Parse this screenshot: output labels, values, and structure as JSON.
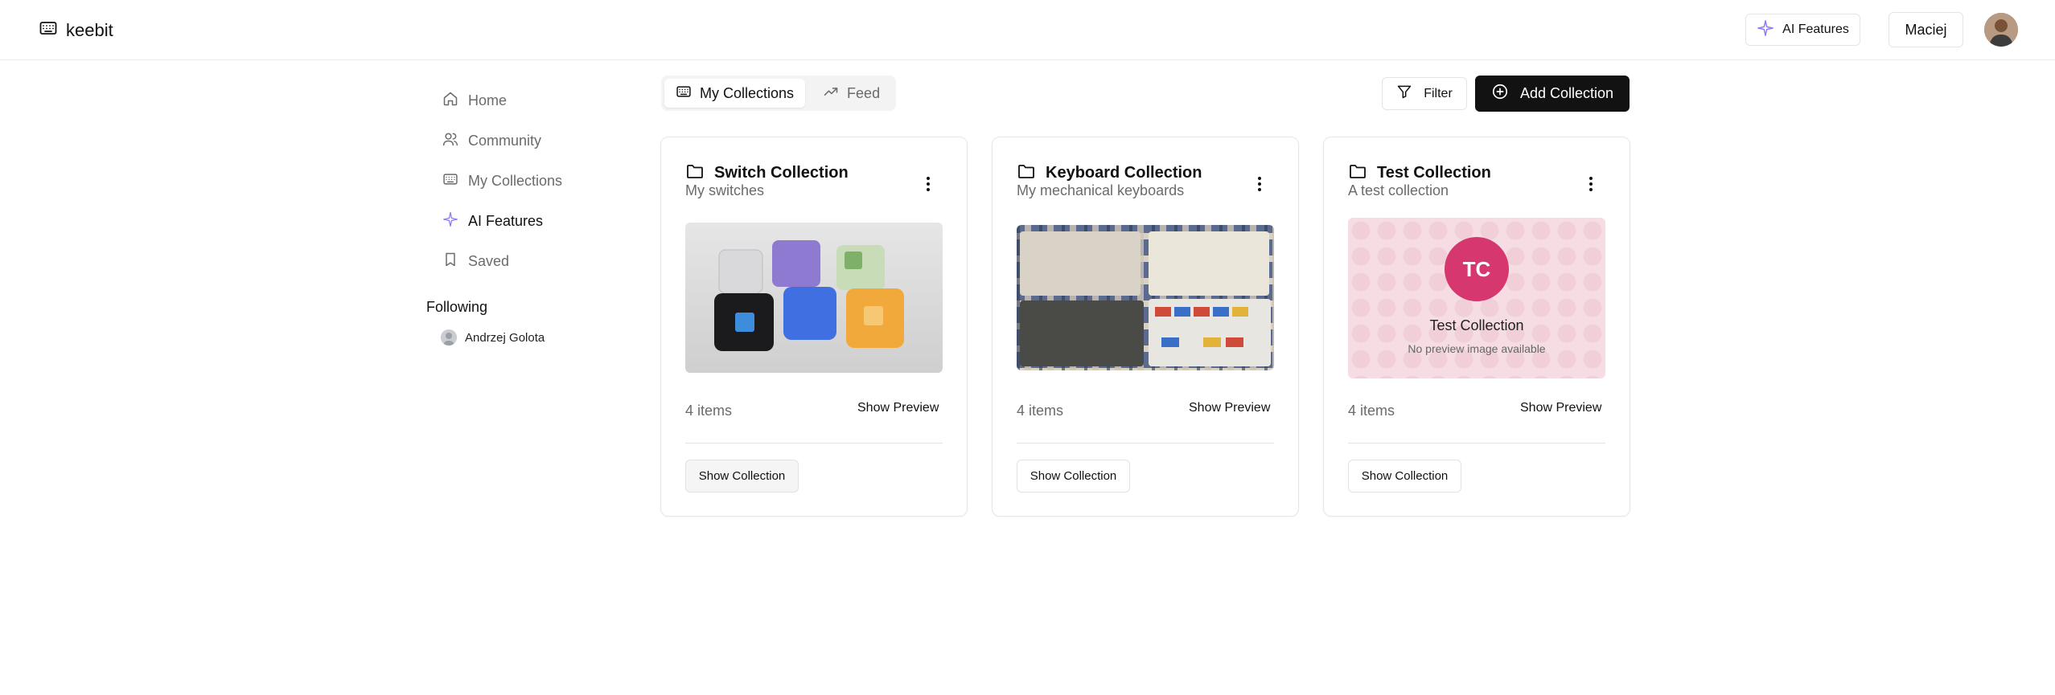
{
  "app": {
    "name": "keebit"
  },
  "header": {
    "ai_label": "AI Features",
    "user_name": "Maciej"
  },
  "sidebar": {
    "items": [
      {
        "label": "Home",
        "icon": "home-icon",
        "active": false
      },
      {
        "label": "Community",
        "icon": "users-icon",
        "active": false
      },
      {
        "label": "My Collections",
        "icon": "keyboard-icon",
        "active": false
      },
      {
        "label": "AI Features",
        "icon": "sparkles-icon",
        "active": true
      },
      {
        "label": "Saved",
        "icon": "bookmark-icon",
        "active": false
      }
    ],
    "following_title": "Following",
    "following": [
      {
        "name": "Andrzej Golota"
      }
    ]
  },
  "tabs": [
    {
      "label": "My Collections",
      "icon": "keyboard-icon",
      "active": true
    },
    {
      "label": "Feed",
      "icon": "trending-up-icon",
      "active": false
    }
  ],
  "actions": {
    "filter_label": "Filter",
    "add_label": "Add Collection"
  },
  "collections": [
    {
      "title": "Switch Collection",
      "subtitle": "My switches",
      "count": "4 items",
      "preview_label": "Show Preview",
      "show_label": "Show Collection",
      "image": "photo of keyboard switches"
    },
    {
      "title": "Keyboard Collection",
      "subtitle": "My mechanical keyboards",
      "count": "4 items",
      "preview_label": "Show Preview",
      "show_label": "Show Collection",
      "image": "photo of mechanical keyboards"
    },
    {
      "title": "Test Collection",
      "subtitle": "A test collection",
      "count": "4 items",
      "preview_label": "Show Preview",
      "show_label": "Show Collection",
      "placeholder": {
        "initials": "TC",
        "title": "Test Collection",
        "note": "No preview image available"
      }
    }
  ],
  "colors": {
    "primary": "#121212",
    "accent_pink": "#d5376e",
    "sparkle": "#8b7cf6"
  }
}
